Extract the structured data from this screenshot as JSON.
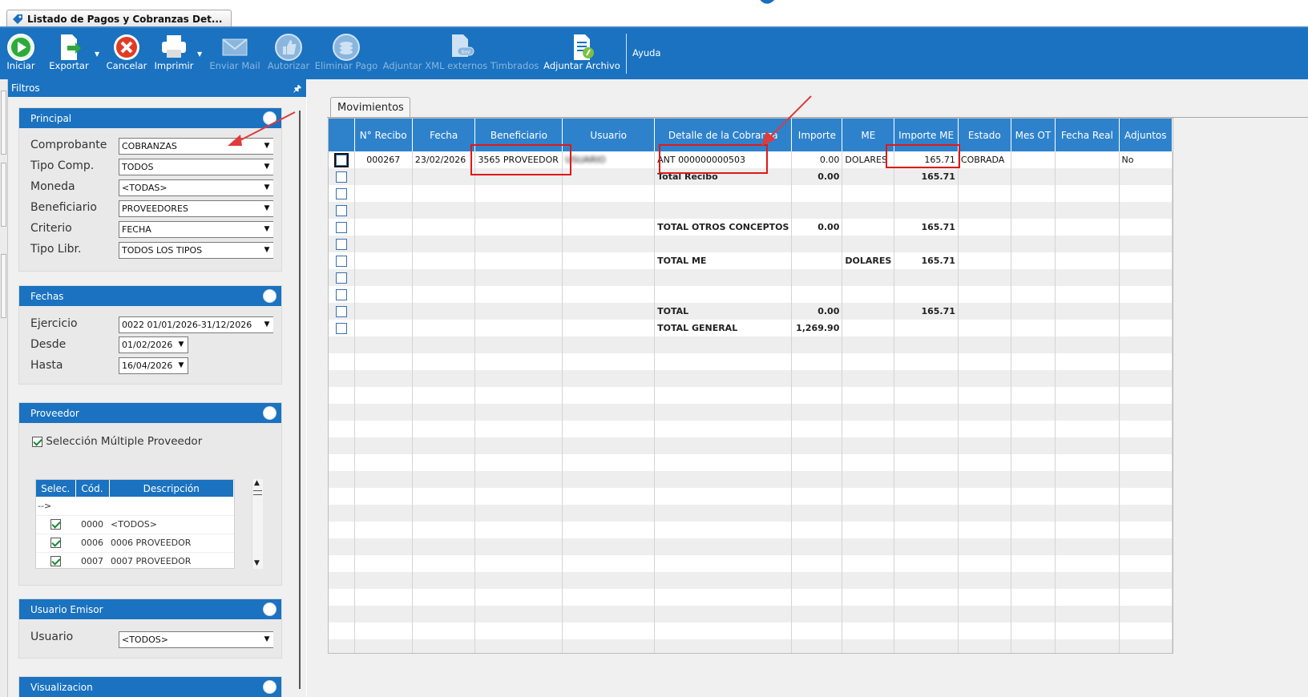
{
  "window_tab": {
    "title": "Listado de Pagos y Cobranzas Det..."
  },
  "toolbar": {
    "iniciar": "Iniciar",
    "exportar": "Exportar",
    "cancelar": "Cancelar",
    "imprimir": "Imprimir",
    "enviar_mail": "Enviar Mail",
    "autorizar": "Autorizar",
    "eliminar_pago": "Eliminar Pago",
    "adjuntar_xml": "Adjuntar XML externos Timbrados",
    "adjuntar_archivo": "Adjuntar Archivo",
    "ayuda": "Ayuda"
  },
  "filtros": {
    "title": "Filtros",
    "principal": {
      "title": "Principal",
      "comprobante_label": "Comprobante",
      "comprobante_value": "COBRANZAS",
      "tipo_comp_label": "Tipo Comp.",
      "tipo_comp_value": "TODOS",
      "moneda_label": "Moneda",
      "moneda_value": "<TODAS>",
      "beneficiario_label": "Beneficiario",
      "beneficiario_value": "PROVEEDORES",
      "criterio_label": "Criterio",
      "criterio_value": "FECHA",
      "tipo_libr_label": "Tipo Libr.",
      "tipo_libr_value": "TODOS LOS TIPOS"
    },
    "fechas": {
      "title": "Fechas",
      "ejercicio_label": "Ejercicio",
      "ejercicio_value": "0022 01/01/2026-31/12/2026",
      "desde_label": "Desde",
      "desde_value": "01/02/2026",
      "hasta_label": "Hasta",
      "hasta_value": "16/04/2026"
    },
    "proveedor": {
      "title": "Proveedor",
      "multiple_label": "Selección Múltiple Proveedor",
      "columns": [
        "Selec.",
        "Cód.",
        "Descripción"
      ],
      "arrow_row": "-->",
      "rows": [
        {
          "cod": "0000",
          "desc": "<TODOS>"
        },
        {
          "cod": "0006",
          "desc": "0006 PROVEEDOR"
        },
        {
          "cod": "0007",
          "desc": "0007 PROVEEDOR"
        }
      ]
    },
    "usuario_emisor": {
      "title": "Usuario Emisor",
      "usuario_label": "Usuario",
      "usuario_value": "<TODOS>"
    },
    "visualizacion": {
      "title": "Visualizacion"
    }
  },
  "movimientos": {
    "tab": "Movimientos",
    "columns": [
      "N° Recibo",
      "Fecha",
      "Beneficiario",
      "Usuario",
      "Detalle de la Cobranza",
      "Importe",
      "ME",
      "Importe ME",
      "Estado",
      "Mes OT",
      "Fecha Real",
      "Adjuntos"
    ],
    "rows": [
      {
        "recibo": "000267",
        "fecha": "23/02/2026",
        "beneficiario": "3565 PROVEEDOR",
        "usuario": "USUARIO",
        "detalle": "ANT 000000000503",
        "importe": "0.00",
        "me": "DOLARES",
        "importe_me": "165.71",
        "estado": "COBRADA",
        "adjuntos": "No"
      },
      {
        "detalle": "Total Recibo",
        "importe": "0.00",
        "importe_me": "165.71"
      },
      {},
      {},
      {
        "detalle": "TOTAL OTROS CONCEPTOS",
        "importe": "0.00",
        "importe_me": "165.71"
      },
      {},
      {
        "detalle": "TOTAL ME",
        "me": "DOLARES",
        "importe_me": "165.71"
      },
      {},
      {},
      {
        "detalle": "TOTAL",
        "importe": "0.00",
        "importe_me": "165.71"
      },
      {
        "detalle": "TOTAL GENERAL",
        "importe": "1,269.90"
      }
    ]
  }
}
